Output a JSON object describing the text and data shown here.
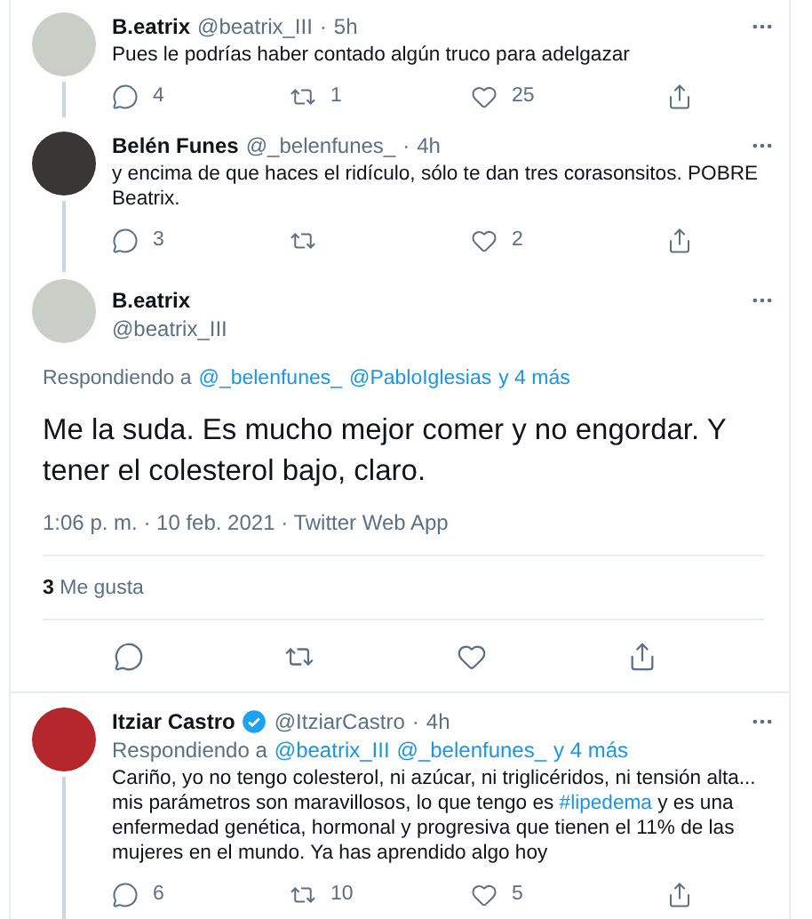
{
  "tweets": [
    {
      "kind": "reply",
      "name": "B.eatrix",
      "verified": false,
      "handle": "@beatrix_III",
      "separator": "·",
      "time": "5h",
      "thread_line": true,
      "body": [
        {
          "text": "Pues le podrías haber contado algún truco para adelgazar"
        }
      ],
      "counts": {
        "reply": "4",
        "retweet": "1",
        "like": "25"
      }
    },
    {
      "kind": "reply",
      "name": "Belén Funes",
      "verified": false,
      "handle": "@_belenfunes_",
      "separator": "·",
      "time": "4h",
      "thread_line": true,
      "body": [
        {
          "text": "y encima de que haces el ridículo, sólo te dan tres corasonsitos. POBRE Beatrix."
        }
      ],
      "counts": {
        "reply": "3",
        "like": "2"
      }
    },
    {
      "kind": "focus",
      "name": "B.eatrix",
      "handle": "@beatrix_III",
      "replying_to": {
        "label": "Respondiendo a",
        "mentions": [
          "@_belenfunes_",
          "@PabloIglesias",
          "y 4 más"
        ]
      },
      "body": [
        {
          "text": "Me la suda. Es mucho mejor comer y no engordar. Y tener el colesterol bajo, claro."
        }
      ],
      "meta": "1:06 p. m. · 10 feb. 2021 · Twitter Web App",
      "likes": {
        "count": "3",
        "label": "Me gusta"
      }
    },
    {
      "kind": "reply",
      "name": "Itziar Castro",
      "verified": true,
      "handle": "@ItziarCastro",
      "separator": "·",
      "time": "4h",
      "thread_line": true,
      "replying_to": {
        "label": "Respondiendo a",
        "mentions": [
          "@beatrix_III",
          "@_belenfunes_",
          "y 4 más"
        ]
      },
      "body": [
        {
          "text": "Cariño, yo no tengo colesterol, ni azúcar, ni triglicéridos, ni tensión alta... mis parámetros son maravillosos, lo que tengo es "
        },
        {
          "text": "#lipedema",
          "kind": "hashtag"
        },
        {
          "text": " y es una enfermedad genética, hormonal y progresiva que tienen el 11% de las mujeres en el mundo. Ya has aprendido algo hoy"
        }
      ],
      "counts": {
        "reply": "6",
        "retweet": "10",
        "like": "5"
      }
    }
  ]
}
